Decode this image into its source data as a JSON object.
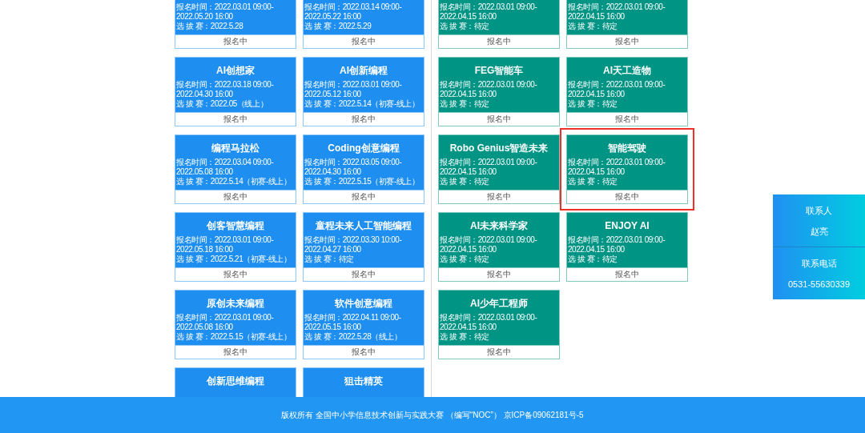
{
  "groups": [
    {
      "color": "#1e8ff0",
      "cards": [
        {
          "time": "报名时间：2022.03.01 09:00-2022.05.20 16:00",
          "round": "选 拔 赛：2022.5.28",
          "status": "报名中",
          "highlighted": false
        },
        {
          "time": "报名时间：2022.03.14 09:00-2022.05.22 16:00",
          "round": "选 拔 赛：2022.5.29",
          "status": "报名中",
          "highlighted": false
        },
        {
          "title": "AI创想家",
          "time": "报名时间：2022.03.18 09:00-2022.04.30 16:00",
          "round": "选 拔 赛：2022.05（线上）",
          "status": "报名中",
          "highlighted": false
        },
        {
          "title": "AI创新编程",
          "time": "报名时间：2022.03.01 09:00-2022.05.12 16:00",
          "round": "选 拔 赛：2022.5.14（初赛-线上）",
          "status": "报名中",
          "highlighted": false
        },
        {
          "title": "编程马拉松",
          "time": "报名时间：2022.03.04 09:00-2022.05.08 16:00",
          "round": "选 拔 赛：2022.5.14（初赛-线上）",
          "status": "报名中",
          "highlighted": false
        },
        {
          "title": "Coding创意编程",
          "time": "报名时间：2022.03.05 09:00-2022.04.30 16:00",
          "round": "选 拔 赛：2022.5.15（初赛-线上）",
          "status": "报名中",
          "highlighted": false
        },
        {
          "title": "创客智慧编程",
          "time": "报名时间：2022.03.01 09:00-2022.05.18 16:00",
          "round": "选 拔 赛：2022.5.21（初赛-线上）",
          "status": "报名中",
          "highlighted": false
        },
        {
          "title": "童程未来人工智能编程",
          "time": "报名时间：2022.03.30 10:00-2022.04.27 16:00",
          "round": "选 拔 赛：待定",
          "status": "报名中",
          "highlighted": false
        },
        {
          "title": "原创未来编程",
          "time": "报名时间：2022.03.01 09:00-2022.05.08 16:00",
          "round": "选 拔 赛：2022.5.15（初赛-线上）",
          "status": "报名中",
          "highlighted": false
        },
        {
          "title": "软件创意编程",
          "time": "报名时间：2022.04.11 09:00-2022.05.15 16:00",
          "round": "选 拔 赛：2022.5.28（线上）",
          "status": "报名中",
          "highlighted": false
        },
        {
          "title": "创新思维编程"
        },
        {
          "title": "狙击精英"
        }
      ]
    },
    {
      "color": "#009485",
      "cards": [
        {
          "time": "报名时间：2022.03.01 09:00-2022.04.15 16:00",
          "round": "选 拔 赛：待定",
          "status": "报名中",
          "highlighted": false
        },
        {
          "time": "报名时间：2022.03.01 09:00-2022.04.15 16:00",
          "round": "选 拔 赛：待定",
          "status": "报名中",
          "highlighted": false
        },
        {
          "title": "FEG智能车",
          "time": "报名时间：2022.03.01 09:00-2022.04.15 16:00",
          "round": "选 拔 赛：待定",
          "status": "报名中",
          "highlighted": false
        },
        {
          "title": "AI天工造物",
          "time": "报名时间：2022.03.01 09:00-2022.04.15 16:00",
          "round": "选 拔 赛：待定",
          "status": "报名中",
          "highlighted": false
        },
        {
          "title": "Robo Genius智造未来",
          "time": "报名时间：2022.03.01 09:00-2022.04.15 16:00",
          "round": "选 拔 赛：待定",
          "status": "报名中",
          "highlighted": false
        },
        {
          "title": "智能驾驶",
          "time": "报名时间：2022.03.01 09:00-2022.04.15 16:00",
          "round": "选 拔 赛：待定",
          "status": "报名中",
          "highlighted": true
        },
        {
          "title": "AI未来科学家",
          "time": "报名时间：2022.03.01 09:00-2022.04.15 16:00",
          "round": "选 拔 赛：待定",
          "status": "报名中",
          "highlighted": false
        },
        {
          "title": "ENJOY AI",
          "time": "报名时间：2022.03.01 09:00-2022.04.15 16:00",
          "round": "选 拔 赛：待定",
          "status": "报名中",
          "highlighted": false
        },
        {
          "title": "AI少年工程师",
          "time": "报名时间：2022.03.01 09:00-2022.04.15 16:00",
          "round": "选 拔 赛：待定",
          "status": "报名中",
          "highlighted": false
        }
      ]
    }
  ],
  "contact": [
    {
      "label": "联系人",
      "value": "赵亮"
    },
    {
      "label": "联系电话",
      "value": "0531-55630339"
    }
  ],
  "footer": "版权所有 全国中小学信息技术创新与实践大赛 （编写“NOC”） 京ICP备09062181号-5"
}
